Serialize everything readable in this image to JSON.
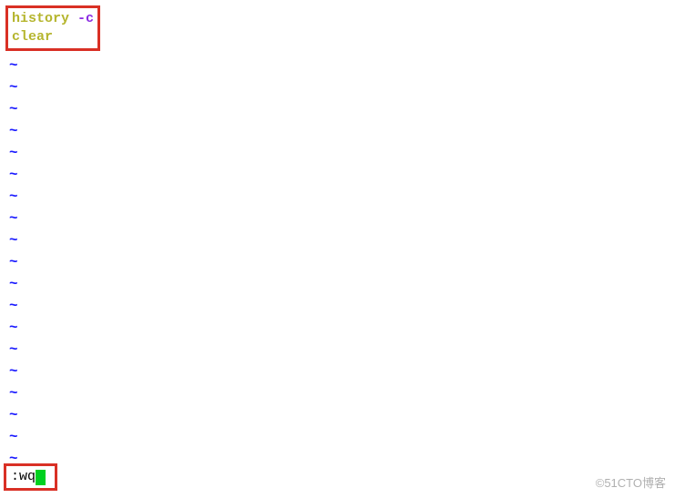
{
  "file_content": {
    "line1_cmd": "history",
    "line1_flag": "-c",
    "line2_cmd": "clear"
  },
  "tilde_char": "~",
  "tilde_count": 19,
  "command_line": {
    "prefix": ":",
    "text": "wq"
  },
  "watermark": "©51CTO博客"
}
